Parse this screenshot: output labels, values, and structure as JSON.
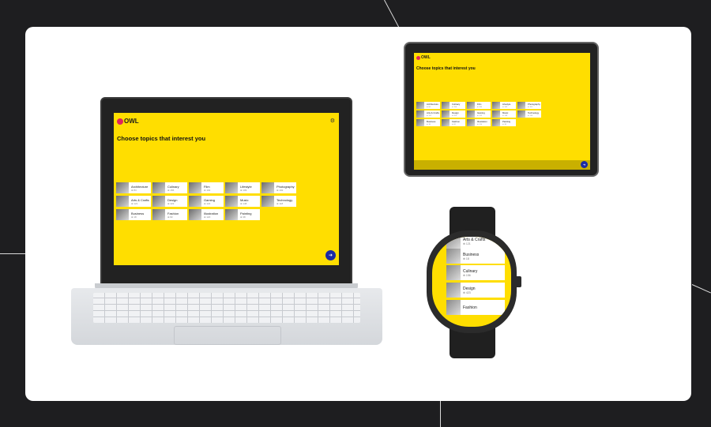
{
  "app": {
    "logo_text": "OWL",
    "headline": "Choose topics that interest you"
  },
  "topics": [
    {
      "name": "Architecture",
      "count": "84"
    },
    {
      "name": "Culinary",
      "count": "156"
    },
    {
      "name": "Film",
      "count": "164"
    },
    {
      "name": "Lifestyle",
      "count": "109"
    },
    {
      "name": "Photography",
      "count": "102"
    },
    {
      "name": "Arts & Crafts",
      "count": "121"
    },
    {
      "name": "Design",
      "count": "423"
    },
    {
      "name": "Gaming",
      "count": "122"
    },
    {
      "name": "Music",
      "count": "148"
    },
    {
      "name": "Technology",
      "count": "118"
    },
    {
      "name": "Business",
      "count": "18"
    },
    {
      "name": "Fashion",
      "count": "82"
    },
    {
      "name": "Illustration",
      "count": "120"
    },
    {
      "name": "Painting",
      "count": "38"
    }
  ],
  "watch_topics": [
    {
      "name": "Arts & Crafts",
      "count": "121"
    },
    {
      "name": "Business",
      "count": "18"
    },
    {
      "name": "Culinary",
      "count": "156"
    },
    {
      "name": "Design",
      "count": "423"
    },
    {
      "name": "Fashion",
      "count": ""
    }
  ],
  "icons": {
    "settings": "gear-icon",
    "fab": "next-icon"
  },
  "colors": {
    "background": "#1e1e20",
    "card": "#ffffff",
    "brand_yellow": "#ffde00",
    "fab_blue": "#1b2aa5",
    "logo_pink": "#e0245e"
  }
}
